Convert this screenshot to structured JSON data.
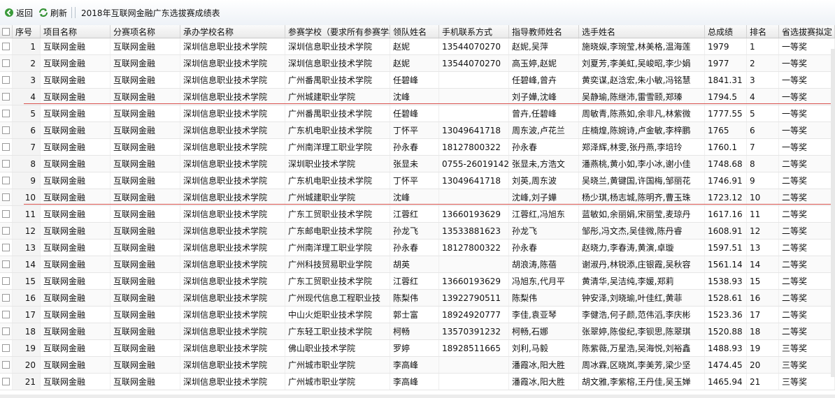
{
  "toolbar": {
    "back_label": "返回",
    "refresh_label": "刷新",
    "title": "2018年互联网金融广东选拔赛成绩表"
  },
  "columns": [
    "序号",
    "项目名称",
    "分赛项名称",
    "承办学校名称",
    "参赛学校（要求所有参赛学校",
    "领队姓名",
    "手机联系方式",
    "指导教师姓名",
    "选手姓名",
    "总成绩",
    "排名",
    "省选拔赛拟定"
  ],
  "rows": [
    [
      "1",
      "互联网金融",
      "互联网金融",
      "深圳信息职业技术学院",
      "深圳信息职业技术学院",
      "赵妮",
      "13544070270",
      "赵妮,吴萍",
      "施晓娱,李琬莹,林美格,温海莲",
      "1979",
      "1",
      "一等奖"
    ],
    [
      "2",
      "互联网金融",
      "互联网金融",
      "深圳信息职业技术学院",
      "深圳信息职业技术学院",
      "赵妮",
      "13544070270",
      "高玉婷,赵妮",
      "刘夏芳,李美虹,吴峻昭,李少娟",
      "1977",
      "2",
      "一等奖"
    ],
    [
      "3",
      "互联网金融",
      "互联网金融",
      "深圳信息职业技术学院",
      "广州番禺职业技术学院",
      "任碧峰",
      "",
      "任碧峰,曾卉",
      "黄奕谋,赵浛宏,朱小敏,冯铭慧",
      "1841.31",
      "3",
      "一等奖"
    ],
    [
      "4",
      "互联网金融",
      "互联网金融",
      "深圳信息职业技术学院",
      "广州城建职业学院",
      "沈峰",
      "",
      "刘子嬅,沈峰",
      "吴静瑜,陈继沛,雷雪颐,郑瑧",
      "1794.5",
      "4",
      "一等奖"
    ],
    [
      "5",
      "互联网金融",
      "互联网金融",
      "深圳信息职业技术学院",
      "广州番禺职业技术学院",
      "任碧峰",
      "",
      "曾卉,任碧峰",
      "周敏青,陈燕如,余非凡,林紫微",
      "1777.55",
      "5",
      "一等奖"
    ],
    [
      "6",
      "互联网金融",
      "互联网金融",
      "深圳信息职业技术学院",
      "广东机电职业技术学院",
      "丁怀平",
      "13049641718",
      "周东波,卢花兰",
      "庄楠煌,陈婉诗,卢金敏,李梓鹏",
      "1765",
      "6",
      "一等奖"
    ],
    [
      "7",
      "互联网金融",
      "互联网金融",
      "深圳信息职业技术学院",
      "广州南洋理工职业学院",
      "孙永春",
      "18127800322",
      "孙永春",
      "郑泽辉,林雯,张丹燕,李培玲",
      "1760.1",
      "7",
      "一等奖"
    ],
    [
      "8",
      "互联网金融",
      "互联网金融",
      "深圳信息职业技术学院",
      "深圳职业技术学院",
      "张显未",
      "0755-26019142",
      "张显未,方浩文",
      "潘燕桃,黄小如,李小冰,谢小佳",
      "1748.68",
      "8",
      "二等奖"
    ],
    [
      "9",
      "互联网金融",
      "互联网金融",
      "深圳信息职业技术学院",
      "广东机电职业技术学院",
      "丁怀平",
      "13049641718",
      "刘英,周东波",
      "吴晓兰,黄键国,许国梅,邹丽花",
      "1746.91",
      "9",
      "二等奖"
    ],
    [
      "10",
      "互联网金融",
      "互联网金融",
      "深圳信息职业技术学院",
      "广州城建职业学院",
      "沈峰",
      "",
      "沈峰,刘子嬅",
      "杨少琪,杨志城,陈明齐,曹玉珠",
      "1723.12",
      "10",
      "二等奖"
    ],
    [
      "11",
      "互联网金融",
      "互联网金融",
      "深圳信息职业技术学院",
      "广东工贸职业技术学院",
      "江蓉红",
      "13660193629",
      "江蓉红,冯旭东",
      "蓝敏如,余丽娟,宋丽莹,麦琼丹",
      "1617.16",
      "11",
      "二等奖"
    ],
    [
      "12",
      "互联网金融",
      "互联网金融",
      "深圳信息职业技术学院",
      "广东邮电职业技术学院",
      "孙龙飞",
      "13533881623",
      "孙龙飞",
      "邹彤,冯文杰,吴佳微,陈丹睿",
      "1608.91",
      "12",
      "二等奖"
    ],
    [
      "13",
      "互联网金融",
      "互联网金融",
      "深圳信息职业技术学院",
      "广州南洋理工职业学院",
      "孙永春",
      "18127800322",
      "孙永春",
      "赵晓力,李春涛,黄演,卓璇",
      "1597.51",
      "13",
      "二等奖"
    ],
    [
      "14",
      "互联网金融",
      "互联网金融",
      "深圳信息职业技术学院",
      "广州科技贸易职业学院",
      "胡英",
      "",
      "胡浪涛,陈蓓",
      "谢淑丹,林锐添,庄银霞,吴秋容",
      "1561.14",
      "14",
      "二等奖"
    ],
    [
      "15",
      "互联网金融",
      "互联网金融",
      "深圳信息职业技术学院",
      "广东工贸职业技术学院",
      "江蓉红",
      "13660193629",
      "冯旭东,代月平",
      "黄清华,吴洁纯,李媛,郑莉",
      "1538.93",
      "15",
      "二等奖"
    ],
    [
      "16",
      "互联网金融",
      "互联网金融",
      "深圳信息职业技术学院",
      "广州现代信息工程职业技",
      "陈梨伟",
      "13922790511",
      "陈梨伟",
      "钟安泽,刘晓瑜,叶佳红,黄菲",
      "1528.61",
      "16",
      "二等奖"
    ],
    [
      "17",
      "互联网金融",
      "互联网金融",
      "深圳信息职业技术学院",
      "中山火炬职业技术学院",
      "郭士富",
      "18924920777",
      "李佳,袁亚琴",
      "李健浩,何子颜,范伟滔,李庆彬",
      "1523.36",
      "17",
      "二等奖"
    ],
    [
      "18",
      "互联网金融",
      "互联网金融",
      "深圳信息职业技术学院",
      "广东轻工职业技术学院",
      "柯畅",
      "13570391232",
      "柯畅,石娜",
      "张翠婷,陈俊纪,李钡思,陈翠琪",
      "1520.88",
      "18",
      "二等奖"
    ],
    [
      "19",
      "互联网金融",
      "互联网金融",
      "深圳信息职业技术学院",
      "佛山职业技术学院",
      "罗婷",
      "18928511665",
      "刘利,马毅",
      "陈紫薇,万星浩,吴海悦,刘裕鑫",
      "1488.93",
      "19",
      "三等奖"
    ],
    [
      "20",
      "互联网金融",
      "互联网金融",
      "深圳信息职业技术学院",
      "广州城市职业学院",
      "李高峰",
      "",
      "潘霞冰,阳大胜",
      "周冰霖,区晓岚,李美芳,梁少坚",
      "1474.45",
      "20",
      "三等奖"
    ],
    [
      "21",
      "互联网金融",
      "互联网金融",
      "深圳信息职业技术学院",
      "广州城市职业学院",
      "李高峰",
      "",
      "潘霞冰,阳大胜",
      "胡文雅,李紫榕,王丹佳,吴玉婵",
      "1465.94",
      "21",
      "三等奖"
    ]
  ]
}
